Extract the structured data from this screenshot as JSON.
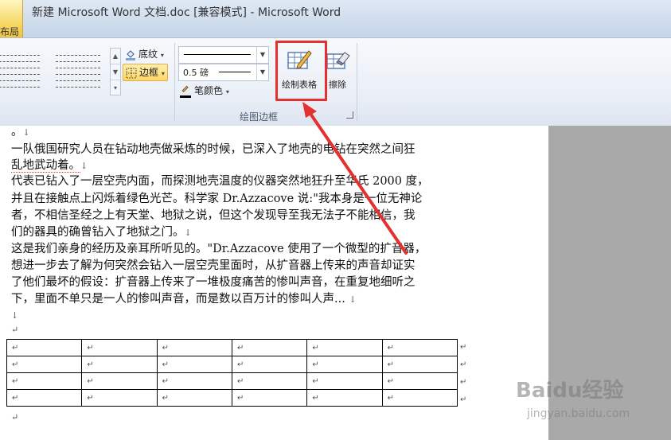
{
  "window": {
    "title": "新建 Microsoft Word 文档.doc [兼容模式] - Microsoft Word",
    "active_tab_label": "布局"
  },
  "ribbon": {
    "shading_label": "底纹",
    "borders_label": "边框",
    "line_weight_value": "0.5 磅",
    "pen_color_label": "笔颜色",
    "draw_table_label": "绘制表格",
    "eraser_label": "擦除",
    "group_draw_borders_label": "绘图边框"
  },
  "document": {
    "line0": "。",
    "line1": "一队俄国研究人员在钻动地壳做采炼的时候，已深入了地壳的电钻在突然之间狂",
    "line2": "乱地武动着。",
    "line3": "代表已钻入了一层空壳内面，而探测地壳温度的仪器突然地狂升至华氏 2000 度，",
    "line4": "并且在接触点上闪烁着绿色光芒。科学家 Dr.Azzacove 说:\"我本身是一位无神论",
    "line5": "者，不相信圣经之上有天堂、地狱之说，但这个发现导至我无法子不能相信，我",
    "line6": "们的器具的确曾钻入了地狱之门。",
    "line7": "这是我们亲身的经历及亲耳所听见的。\"Dr.Azzacove 使用了一个微型的扩音器，",
    "line8": "想进一步去了解为何突然会钻入一层空壳里面时，从扩音器上传来的声音却证实",
    "line9": "了他们最坏的假设：扩音器上传来了一堆极度痛苦的惨叫声音，在重复地细听之",
    "line10": "下，里面不单只是一人的惨叫声音，而是数以百万计的惨叫人声...",
    "para_mark": "↓",
    "cell_mark": "↵"
  },
  "watermark": {
    "brand": "Baidu经验",
    "url": "jingyan.baidu.com"
  },
  "colors": {
    "highlight": "#e53030",
    "ribbon_bg": "#e9eef6"
  }
}
